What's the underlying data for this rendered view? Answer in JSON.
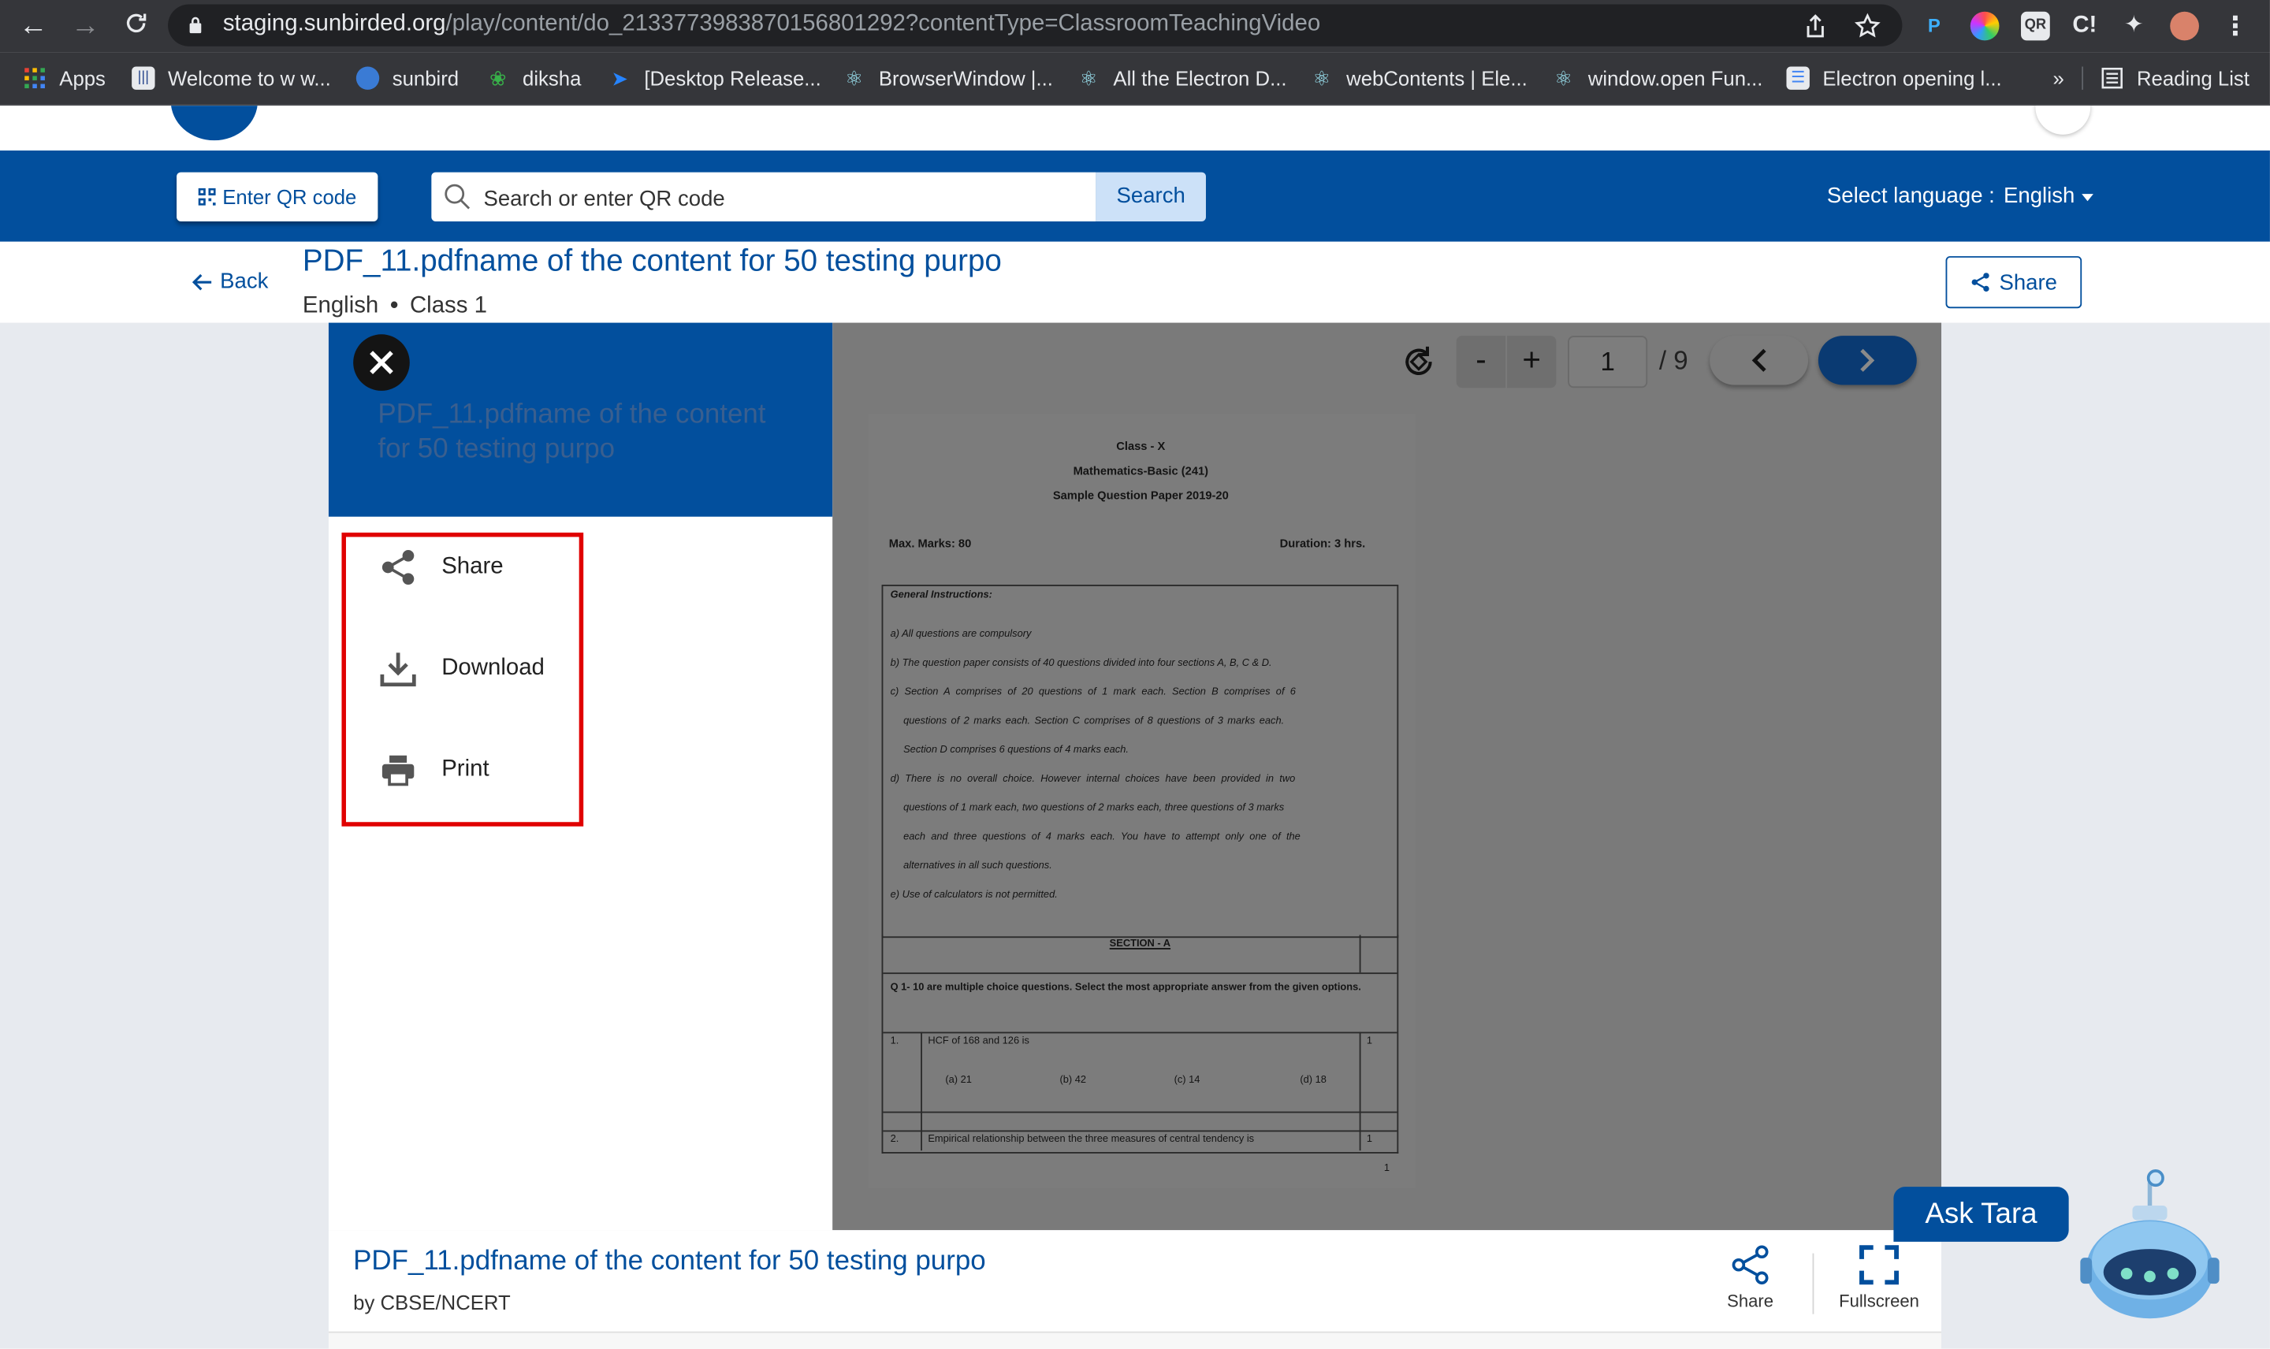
{
  "browser": {
    "url_host": "staging.sunbirded.org",
    "url_path": "/play/content/do_2133773983870156801292?contentType=ClassroomTeachingVideo",
    "bookmarks": [
      {
        "label": "Apps"
      },
      {
        "label": "Welcome to w w..."
      },
      {
        "label": "sunbird"
      },
      {
        "label": "diksha"
      },
      {
        "label": "[Desktop Release..."
      },
      {
        "label": "BrowserWindow |..."
      },
      {
        "label": "All the Electron D..."
      },
      {
        "label": "webContents | Ele..."
      },
      {
        "label": "window.open Fun..."
      },
      {
        "label": "Electron opening l..."
      }
    ],
    "overflow_label": "»",
    "reading_list_label": "Reading List"
  },
  "header": {
    "qr_button_label": "Enter QR code",
    "search_placeholder": "Search or enter QR code",
    "search_button_label": "Search",
    "language_label": "Select language  :",
    "language_value": "English"
  },
  "content": {
    "back_label": "Back",
    "title": "PDF_11.pdfname of the content for 50 testing purpo",
    "language": "English",
    "class": "Class 1",
    "share_label": "Share"
  },
  "menu": {
    "title": "PDF_11.pdfname of the content for 50 testing purpo",
    "items": [
      {
        "label": "Share",
        "icon": "share-icon"
      },
      {
        "label": "Download",
        "icon": "download-icon"
      },
      {
        "label": "Print",
        "icon": "print-icon"
      }
    ]
  },
  "pdf_toolbar": {
    "zoom_out": "-",
    "zoom_in": "+",
    "current_page": "1",
    "total_pages": "/ 9"
  },
  "pdf_page": {
    "class_line": "Class - X",
    "subject_line": "Mathematics-Basic (241)",
    "paper_line": "Sample Question Paper 2019-20",
    "max_marks": "Max. Marks: 80",
    "duration": "Duration: 3 hrs.",
    "instructions_title": "General Instructions:",
    "instructions": [
      "a) All questions are compulsory",
      "b) The question paper consists of 40 questions divided into four sections A, B, C & D.",
      "c) Section A comprises of 20 questions of 1 mark each. Section B comprises of 6",
      "questions of 2 marks each. Section C comprises of 8 questions of 3 marks each.",
      "Section D comprises 6 questions of 4 marks each.",
      "d) There is no overall choice. However internal choices have been provided in two",
      "questions of 1 mark each, two questions of 2 marks each, three questions of 3 marks",
      "each and three questions of 4 marks each. You have to attempt only one of the",
      "alternatives in all such questions.",
      "e) Use of calculators is not permitted."
    ],
    "section_heading": "SECTION - A",
    "mcq_note": "Q 1- 10 are multiple choice questions. Select the most appropriate answer from the given options.",
    "q1_num": "1.",
    "q1_text": "HCF of 168 and 126 is",
    "q1_marks": "1",
    "q1_options": [
      "(a) 21",
      "(b) 42",
      "(c) 14",
      "(d) 18"
    ],
    "q2_num": "2.",
    "q2_text": "Empirical relationship between the three measures of central tendency is",
    "q2_marks": "1",
    "page_number": "1"
  },
  "bottom": {
    "title": "PDF_11.pdfname of the content for 50 testing purpo",
    "by": "by CBSE/NCERT",
    "share_label": "Share",
    "fullscreen_label": "Fullscreen"
  },
  "assistant": {
    "label": "Ask Tara"
  },
  "colors": {
    "brand_blue": "#024f9d",
    "highlight_red": "#e00000",
    "player_gray": "#7a7a7a"
  }
}
